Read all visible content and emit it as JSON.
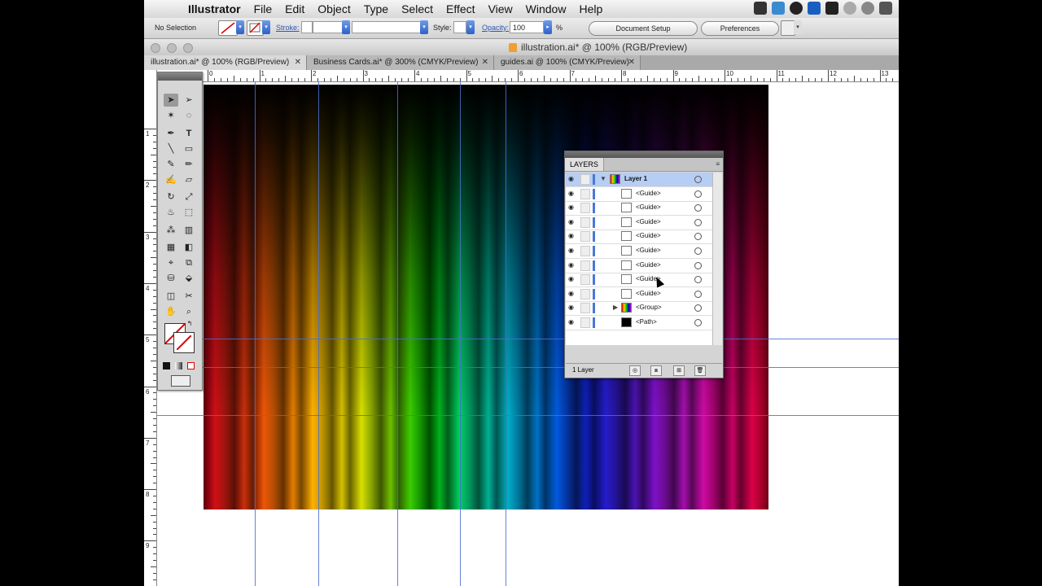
{
  "menubar": {
    "app_name": "Illustrator",
    "items": [
      "File",
      "Edit",
      "Object",
      "Type",
      "Select",
      "Effect",
      "View",
      "Window",
      "Help"
    ]
  },
  "control_bar": {
    "selection_label": "No Selection",
    "stroke_label": "Stroke:",
    "style_label": "Style:",
    "opacity_label": "Opacity:",
    "opacity_value": "100",
    "percent_sign": "%",
    "document_setup_label": "Document Setup",
    "preferences_label": "Preferences"
  },
  "window": {
    "title": "illustration.ai* @ 100% (RGB/Preview)"
  },
  "tabs": [
    {
      "label": "illustration.ai* @ 100% (RGB/Preview)",
      "active": true
    },
    {
      "label": "Business Cards.ai* @ 300% (CMYK/Preview)",
      "active": false
    },
    {
      "label": "guides.ai @ 100% (CMYK/Preview)",
      "active": false
    }
  ],
  "rulers": {
    "horizontal_numbers": [
      "0",
      "1",
      "2",
      "3",
      "4",
      "5",
      "6",
      "7",
      "8",
      "9",
      "10",
      "11",
      "12",
      "13"
    ],
    "vertical_numbers": [
      "1",
      "2",
      "3",
      "4",
      "5",
      "6",
      "7",
      "8",
      "9"
    ]
  },
  "layers_panel": {
    "tab_label": "LAYERS",
    "rows": [
      {
        "name": "Layer 1",
        "type": "layer"
      },
      {
        "name": "<Guide>",
        "type": "guide"
      },
      {
        "name": "<Guide>",
        "type": "guide"
      },
      {
        "name": "<Guide>",
        "type": "guide"
      },
      {
        "name": "<Guide>",
        "type": "guide"
      },
      {
        "name": "<Guide>",
        "type": "guide"
      },
      {
        "name": "<Guide>",
        "type": "guide"
      },
      {
        "name": "<Guide>",
        "type": "guide"
      },
      {
        "name": "<Guide>",
        "type": "guide"
      },
      {
        "name": "<Group>",
        "type": "group"
      },
      {
        "name": "<Path>",
        "type": "path"
      }
    ],
    "footer_count": "1 Layer"
  },
  "colors": {
    "guide": "#4a6fd0",
    "layer_highlight": "#b6cdf4"
  }
}
